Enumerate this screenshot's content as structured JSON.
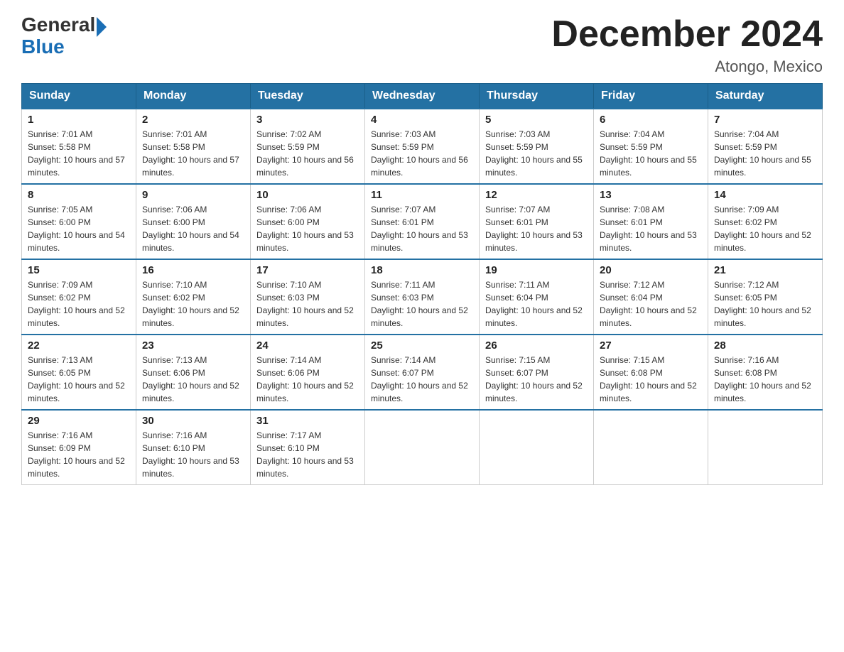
{
  "header": {
    "logo_general": "General",
    "logo_blue": "Blue",
    "month_title": "December 2024",
    "location": "Atongo, Mexico"
  },
  "weekdays": [
    "Sunday",
    "Monday",
    "Tuesday",
    "Wednesday",
    "Thursday",
    "Friday",
    "Saturday"
  ],
  "weeks": [
    [
      {
        "day": "1",
        "sunrise": "7:01 AM",
        "sunset": "5:58 PM",
        "daylight": "10 hours and 57 minutes."
      },
      {
        "day": "2",
        "sunrise": "7:01 AM",
        "sunset": "5:58 PM",
        "daylight": "10 hours and 57 minutes."
      },
      {
        "day": "3",
        "sunrise": "7:02 AM",
        "sunset": "5:59 PM",
        "daylight": "10 hours and 56 minutes."
      },
      {
        "day": "4",
        "sunrise": "7:03 AM",
        "sunset": "5:59 PM",
        "daylight": "10 hours and 56 minutes."
      },
      {
        "day": "5",
        "sunrise": "7:03 AM",
        "sunset": "5:59 PM",
        "daylight": "10 hours and 55 minutes."
      },
      {
        "day": "6",
        "sunrise": "7:04 AM",
        "sunset": "5:59 PM",
        "daylight": "10 hours and 55 minutes."
      },
      {
        "day": "7",
        "sunrise": "7:04 AM",
        "sunset": "5:59 PM",
        "daylight": "10 hours and 55 minutes."
      }
    ],
    [
      {
        "day": "8",
        "sunrise": "7:05 AM",
        "sunset": "6:00 PM",
        "daylight": "10 hours and 54 minutes."
      },
      {
        "day": "9",
        "sunrise": "7:06 AM",
        "sunset": "6:00 PM",
        "daylight": "10 hours and 54 minutes."
      },
      {
        "day": "10",
        "sunrise": "7:06 AM",
        "sunset": "6:00 PM",
        "daylight": "10 hours and 53 minutes."
      },
      {
        "day": "11",
        "sunrise": "7:07 AM",
        "sunset": "6:01 PM",
        "daylight": "10 hours and 53 minutes."
      },
      {
        "day": "12",
        "sunrise": "7:07 AM",
        "sunset": "6:01 PM",
        "daylight": "10 hours and 53 minutes."
      },
      {
        "day": "13",
        "sunrise": "7:08 AM",
        "sunset": "6:01 PM",
        "daylight": "10 hours and 53 minutes."
      },
      {
        "day": "14",
        "sunrise": "7:09 AM",
        "sunset": "6:02 PM",
        "daylight": "10 hours and 52 minutes."
      }
    ],
    [
      {
        "day": "15",
        "sunrise": "7:09 AM",
        "sunset": "6:02 PM",
        "daylight": "10 hours and 52 minutes."
      },
      {
        "day": "16",
        "sunrise": "7:10 AM",
        "sunset": "6:02 PM",
        "daylight": "10 hours and 52 minutes."
      },
      {
        "day": "17",
        "sunrise": "7:10 AM",
        "sunset": "6:03 PM",
        "daylight": "10 hours and 52 minutes."
      },
      {
        "day": "18",
        "sunrise": "7:11 AM",
        "sunset": "6:03 PM",
        "daylight": "10 hours and 52 minutes."
      },
      {
        "day": "19",
        "sunrise": "7:11 AM",
        "sunset": "6:04 PM",
        "daylight": "10 hours and 52 minutes."
      },
      {
        "day": "20",
        "sunrise": "7:12 AM",
        "sunset": "6:04 PM",
        "daylight": "10 hours and 52 minutes."
      },
      {
        "day": "21",
        "sunrise": "7:12 AM",
        "sunset": "6:05 PM",
        "daylight": "10 hours and 52 minutes."
      }
    ],
    [
      {
        "day": "22",
        "sunrise": "7:13 AM",
        "sunset": "6:05 PM",
        "daylight": "10 hours and 52 minutes."
      },
      {
        "day": "23",
        "sunrise": "7:13 AM",
        "sunset": "6:06 PM",
        "daylight": "10 hours and 52 minutes."
      },
      {
        "day": "24",
        "sunrise": "7:14 AM",
        "sunset": "6:06 PM",
        "daylight": "10 hours and 52 minutes."
      },
      {
        "day": "25",
        "sunrise": "7:14 AM",
        "sunset": "6:07 PM",
        "daylight": "10 hours and 52 minutes."
      },
      {
        "day": "26",
        "sunrise": "7:15 AM",
        "sunset": "6:07 PM",
        "daylight": "10 hours and 52 minutes."
      },
      {
        "day": "27",
        "sunrise": "7:15 AM",
        "sunset": "6:08 PM",
        "daylight": "10 hours and 52 minutes."
      },
      {
        "day": "28",
        "sunrise": "7:16 AM",
        "sunset": "6:08 PM",
        "daylight": "10 hours and 52 minutes."
      }
    ],
    [
      {
        "day": "29",
        "sunrise": "7:16 AM",
        "sunset": "6:09 PM",
        "daylight": "10 hours and 52 minutes."
      },
      {
        "day": "30",
        "sunrise": "7:16 AM",
        "sunset": "6:10 PM",
        "daylight": "10 hours and 53 minutes."
      },
      {
        "day": "31",
        "sunrise": "7:17 AM",
        "sunset": "6:10 PM",
        "daylight": "10 hours and 53 minutes."
      },
      null,
      null,
      null,
      null
    ]
  ]
}
